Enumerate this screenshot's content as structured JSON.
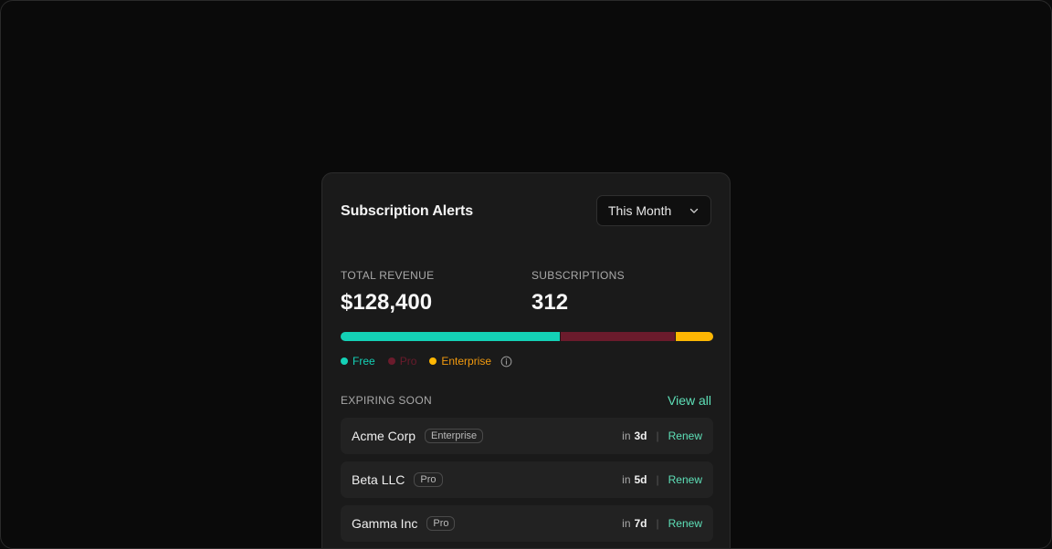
{
  "card": {
    "title": "Subscription Alerts",
    "period": "This Month"
  },
  "stats": {
    "revenue_caption": "TOTAL REVENUE",
    "revenue_value": "$128,400",
    "subs_caption": "SUBSCRIPTIONS",
    "subs_value": "312"
  },
  "plan_mix": {
    "segments": [
      {
        "name": "Free",
        "share": 0.59,
        "color": "#14d1b6"
      },
      {
        "name": "Pro",
        "share": 0.31,
        "color": "#6b1b2c"
      },
      {
        "name": "Enterprise",
        "share": 0.1,
        "color": "#ffb703"
      }
    ],
    "legend": [
      {
        "label": "Free",
        "color": "#14d1b6",
        "text_color": "#14d1b6"
      },
      {
        "label": "Pro",
        "color": "#6b1b2c",
        "text_color": "#6b1b2c"
      },
      {
        "label": "Enterprise",
        "color": "#ffb703",
        "text_color": "#f29a0f"
      }
    ],
    "info_icon": "info-icon"
  },
  "expiring": {
    "caption": "EXPIRING SOON",
    "view_all": "View all",
    "rows": [
      {
        "name": "Acme Corp",
        "plan": "Enterprise",
        "in": "in",
        "days": "3d",
        "action": "Renew"
      },
      {
        "name": "Beta LLC",
        "plan": "Pro",
        "in": "in",
        "days": "5d",
        "action": "Renew"
      },
      {
        "name": "Gamma Inc",
        "plan": "Pro",
        "in": "in",
        "days": "7d",
        "action": "Renew"
      }
    ]
  },
  "colors": {
    "accent": "#5ee0b8",
    "background": "#0a0a0a",
    "card": "#1a1a1a"
  }
}
